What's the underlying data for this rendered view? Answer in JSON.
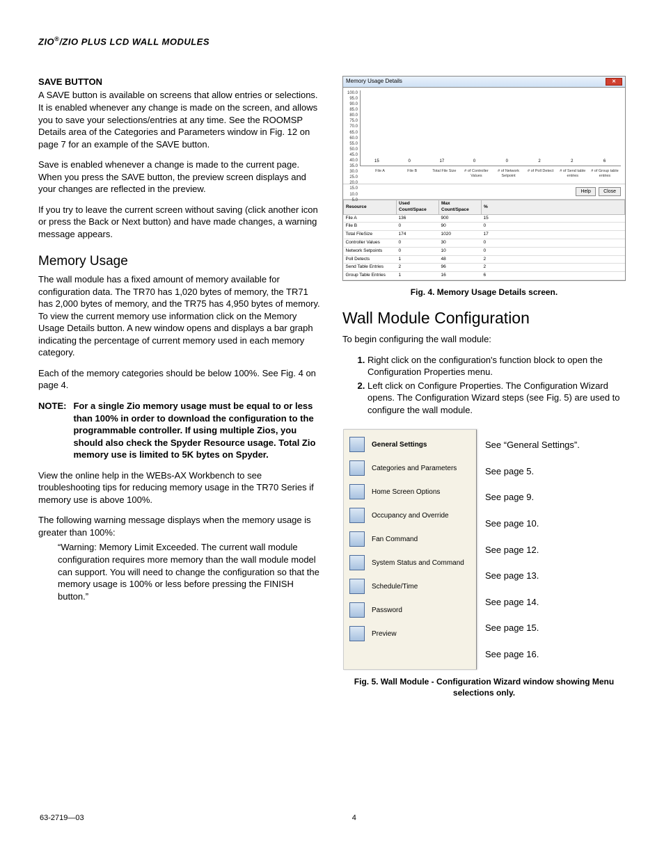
{
  "header": {
    "title": "ZIO®/ZIO PLUS LCD WALL MODULES"
  },
  "left": {
    "save_heading": "SAVE BUTTON",
    "save_p1": "A SAVE button is available on screens that allow entries or selections. It is enabled whenever any change is made on the screen, and allows you to save your selections/entries at any time. See the ROOMSP Details area of the Categories and Parameters window in Fig. 12 on page 7 for an example of the SAVE button.",
    "save_p2": "Save is enabled whenever a change is made to the current page. When you press the SAVE button, the preview screen displays and your changes are reflected in the preview.",
    "save_p3": "If you try to leave the current screen without saving (click another icon or press the Back or Next button) and have made changes, a warning message appears.",
    "mem_heading": "Memory Usage",
    "mem_p1": "The wall module has a fixed amount of memory available for configuration data. The TR70 has 1,020 bytes of memory, the TR71 has 2,000 bytes of memory, and the TR75 has 4,950 bytes of memory. To view the current memory use information click on the Memory Usage Details button. A new window opens and displays a bar graph indicating the percentage of current memory used in each memory category.",
    "mem_p2": "Each of the memory categories should be below 100%. See Fig. 4 on page 4.",
    "note_label": "NOTE:",
    "note_body": "For a single Zio memory usage must be equal to or less than 100% in order to download the configuration to the programmable controller. If using multiple Zios, you should also check the Spyder Resource usage. Total Zio memory use is limited to 5K bytes on Spyder.",
    "mem_p3": "View the online help in the WEBs-AX Workbench to see troubleshooting tips for reducing memory usage in the TR70 Series if memory use is above 100%.",
    "mem_p4": "The following warning message displays when the memory usage is greater than 100%:",
    "mem_quote": "“Warning: Memory Limit Exceeded. The current wall module configuration requires more memory than the wall module model can support. You will need to change the configuration so that the memory usage is 100% or less before pressing the FINISH button.”"
  },
  "right": {
    "mem_window_title": "Memory Usage Details",
    "help_btn": "Help",
    "close_btn": "Close",
    "table_headers": [
      "Resource",
      "Used Count/Space",
      "Max Count/Space",
      "%"
    ],
    "table_rows": [
      [
        "File A",
        "136",
        "900",
        "15"
      ],
      [
        "File B",
        "0",
        "90",
        "0"
      ],
      [
        "Total FileSize",
        "174",
        "1020",
        "17"
      ],
      [
        "Controller Values",
        "0",
        "30",
        "0"
      ],
      [
        "Network Setpoints",
        "0",
        "10",
        "0"
      ],
      [
        "Poll Detects",
        "1",
        "48",
        "2"
      ],
      [
        "Send Table Entries",
        "2",
        "96",
        "2"
      ],
      [
        "Group Table Entries",
        "1",
        "16",
        "6"
      ]
    ],
    "fig4": "Fig. 4. Memory Usage Details screen.",
    "wmcfg_heading": "Wall Module Configuration",
    "wmcfg_intro": "To begin configuring the wall module:",
    "steps": [
      "Right click on the configuration's function block to open the Configuration Properties menu.",
      "Left click on Configure Properties. The Configuration Wizard opens. The Configuration Wizard steps (see Fig. 5) are used to configure the wall module."
    ],
    "wizard_items": [
      {
        "label": "General Settings",
        "ref": "See “General Settings”."
      },
      {
        "label": "Categories and Parameters",
        "ref": "See page 5."
      },
      {
        "label": "Home Screen Options",
        "ref": "See page 9."
      },
      {
        "label": "Occupancy and Override",
        "ref": "See page 10."
      },
      {
        "label": "Fan Command",
        "ref": "See page 12."
      },
      {
        "label": "System Status and Command",
        "ref": "See page 13."
      },
      {
        "label": "Schedule/Time",
        "ref": "See page 14."
      },
      {
        "label": "Password",
        "ref": "See page 15."
      },
      {
        "label": "Preview",
        "ref": "See page 16."
      }
    ],
    "fig5": "Fig. 5. Wall Module - Configuration Wizard window showing Menu selections only."
  },
  "chart_data": {
    "type": "bar",
    "title": "Memory Usage Details",
    "ylabel": "",
    "ylim": [
      5,
      100
    ],
    "yticks": [
      100.0,
      95.0,
      90.0,
      85.0,
      80.0,
      75.0,
      70.0,
      65.0,
      60.0,
      55.0,
      50.0,
      45.0,
      40.0,
      35.0,
      30.0,
      25.0,
      20.0,
      15.0,
      10.0,
      5.0
    ],
    "categories": [
      "File A",
      "File B",
      "Total File Size",
      "# of Controller Values",
      "# of Network Setpoint",
      "# of Poll Detect",
      "# of Send table entries",
      "# of Group table entries"
    ],
    "values": [
      15,
      0,
      17,
      0,
      0,
      2,
      2,
      6
    ]
  },
  "footer": {
    "doc_id": "63-2719—03",
    "page": "4"
  }
}
